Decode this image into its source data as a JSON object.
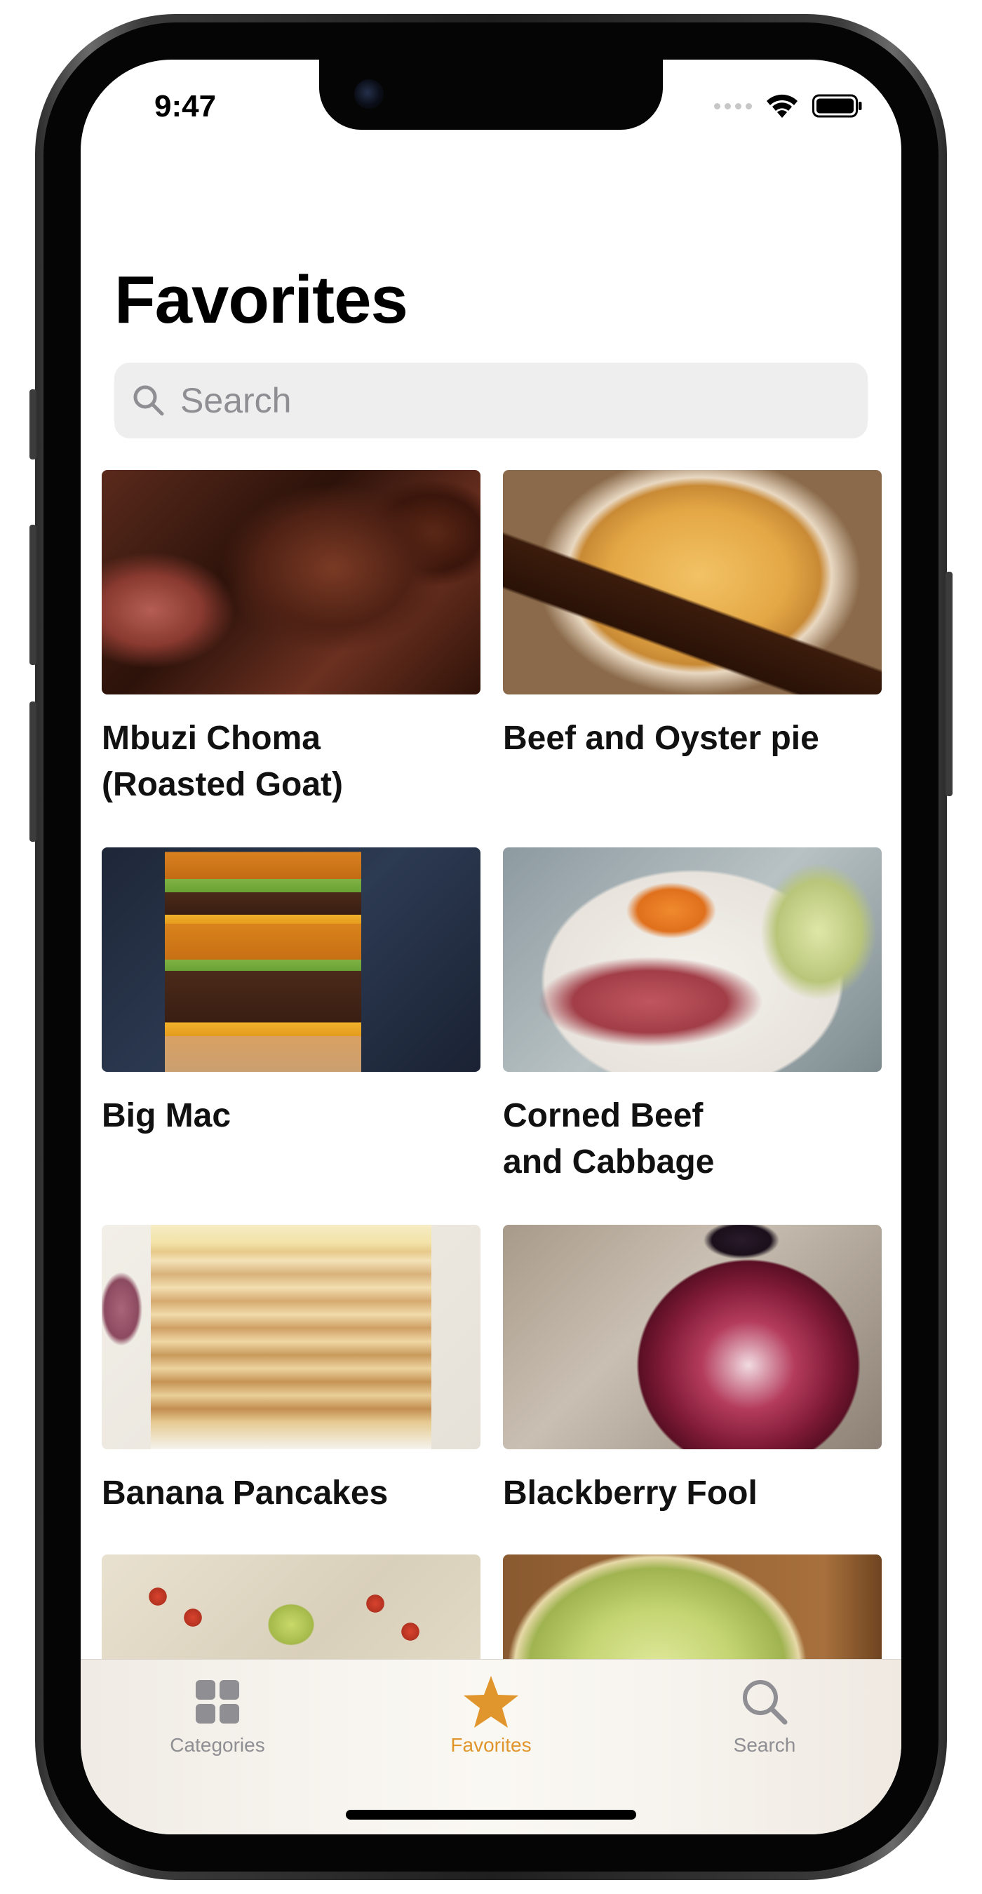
{
  "status_bar": {
    "time": "9:47",
    "icons": [
      "cellular-dots-icon",
      "wifi-icon",
      "battery-icon"
    ]
  },
  "page": {
    "title": "Favorites"
  },
  "search": {
    "placeholder": "Search"
  },
  "recipes": [
    {
      "title_line1": "Mbuzi Choma",
      "title_line2": "(Roasted Goat)",
      "image": "roasted-goat-photo"
    },
    {
      "title_line1": "Beef and Oyster pie",
      "title_line2": "",
      "image": "beef-oyster-pie-photo"
    },
    {
      "title_line1": "Big Mac",
      "title_line2": "",
      "image": "big-mac-photo"
    },
    {
      "title_line1": "Corned Beef",
      "title_line2": "and Cabbage",
      "image": "corned-beef-photo"
    },
    {
      "title_line1": "Banana Pancakes",
      "title_line2": "",
      "image": "banana-pancakes-photo"
    },
    {
      "title_line1": "Blackberry Fool",
      "title_line2": "",
      "image": "blackberry-fool-photo"
    },
    {
      "title_line1": "",
      "title_line2": "",
      "image": "chickpea-tacos-photo"
    },
    {
      "title_line1": "",
      "title_line2": "",
      "image": "leek-quiche-photo"
    }
  ],
  "tab_bar": {
    "tabs": [
      {
        "label": "Categories",
        "icon": "grid-icon",
        "active": false
      },
      {
        "label": "Favorites",
        "icon": "star-icon",
        "active": true
      },
      {
        "label": "Search",
        "icon": "magnifier-icon",
        "active": false
      }
    ],
    "active_color": "#e0962c",
    "inactive_color": "#8e8e93"
  }
}
